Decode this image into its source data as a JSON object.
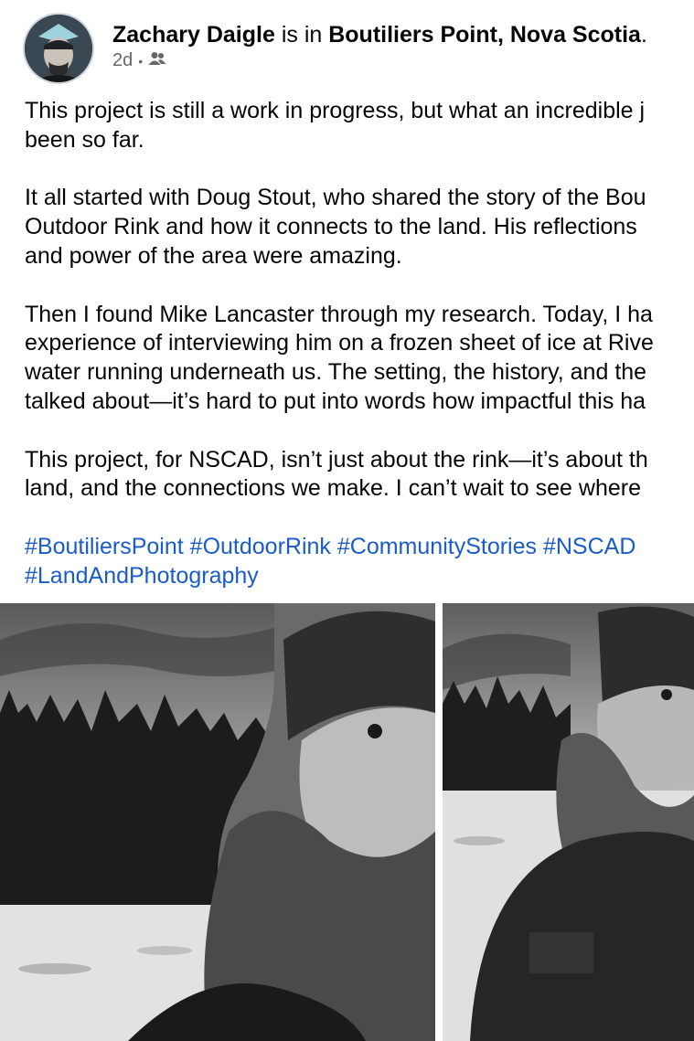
{
  "post": {
    "author": "Zachary Daigle",
    "location_prefix": "is in",
    "location": "Boutiliers Point, Nova Scotia",
    "location_suffix": ".",
    "time": "2d",
    "audience_icon": "friends-icon",
    "paragraphs": [
      [
        "This project is still a work in progress, but what an incredible j",
        "been so far."
      ],
      [
        "It all started with Doug Stout, who shared the story of the Bou",
        "Outdoor Rink and how it connects to the land. His reflections",
        "and power of the area were amazing."
      ],
      [
        "Then I found Mike Lancaster through my research. Today, I ha",
        "experience of interviewing him on a frozen sheet of ice at Rive",
        "water running underneath us. The setting, the history, and the",
        "talked about—it’s hard to put into words how impactful this ha"
      ],
      [
        "This project, for NSCAD, isn’t just about the rink—it’s about th",
        "land, and the connections we make. I can’t wait to see where"
      ]
    ],
    "hashtags": [
      "#BoutiliersPoint",
      "#OutdoorRink",
      "#CommunityStories",
      "#NSCAD",
      "#LandAndPhotography"
    ]
  },
  "colors": {
    "text": "#050505",
    "meta": "#65676b",
    "link": "#1a5cc8"
  },
  "photos": [
    {
      "subject": "black-and-white portrait of bearded man in knit hat beside frozen rink and evergreen trees"
    },
    {
      "subject": "black-and-white portrait of bearded man in jacket on frozen ice with trees behind"
    }
  ]
}
